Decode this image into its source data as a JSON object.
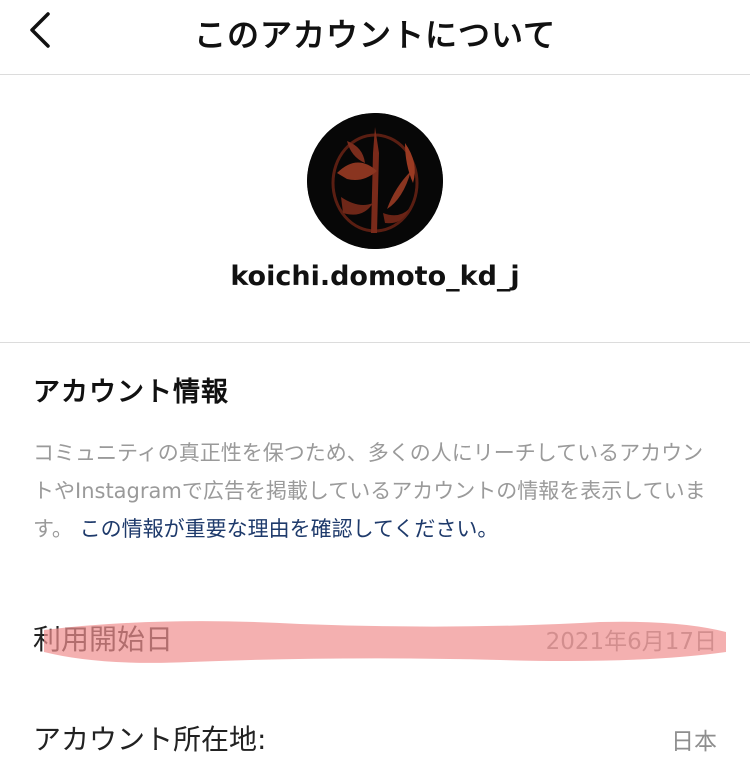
{
  "header": {
    "title": "このアカウントについて",
    "back_icon": "chevron-left-icon"
  },
  "profile": {
    "avatar_icon": "profile-emblem-avatar",
    "username": "koichi.domoto_kd_j"
  },
  "account_info": {
    "title": "アカウント情報",
    "description": "コミュニティの真正性を保つため、多くの人にリーチしているアカウントやInstagramで広告を掲載しているアカウントの情報を表示しています。",
    "link_text": "この情報が重要な理由を確認してください。"
  },
  "rows": [
    {
      "label": "利用開始日",
      "value": "2021年6月17日"
    },
    {
      "label": "アカウント所在地:",
      "value": "日本"
    }
  ],
  "colors": {
    "link": "#1e3a6b",
    "highlighter": "#ef8f8f",
    "divider": "#dcdcdc"
  }
}
